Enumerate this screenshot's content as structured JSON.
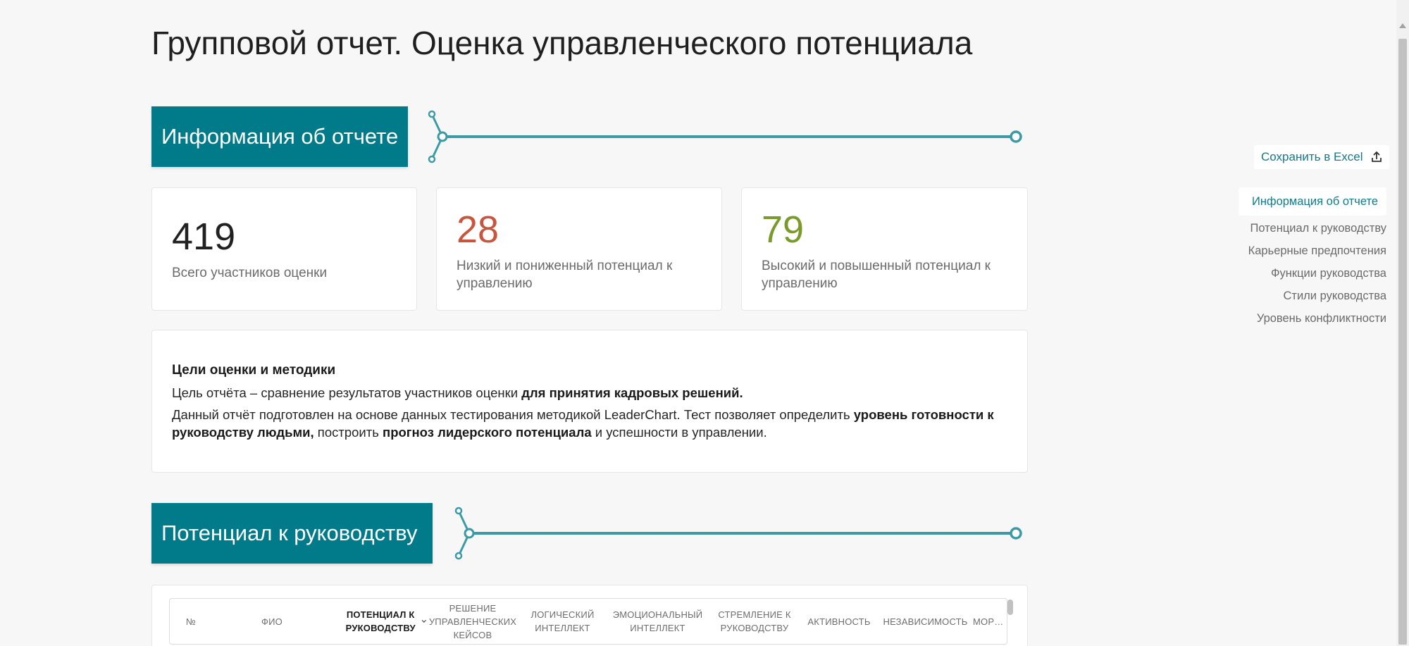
{
  "page": {
    "title": "Групповой отчет. Оценка управленческого потенциала"
  },
  "sections": {
    "info": {
      "title": "Информация об отчете"
    },
    "potential": {
      "title": "Потенциал к руководству"
    }
  },
  "colors": {
    "accent": "#017a8a",
    "low": "#c8553d",
    "high": "#7a9a2b",
    "line": "#3b9aa6"
  },
  "stats": [
    {
      "value": "419",
      "label": "Всего участников оценки",
      "color": "#1a1a1a"
    },
    {
      "value": "28",
      "label": "Низкий и пониженный потенциал к управлению",
      "color": "#c8553d"
    },
    {
      "value": "79",
      "label": "Высокий и повышенный потенциал к управлению",
      "color": "#7a9a2b"
    }
  ],
  "goals": {
    "title": "Цели оценки и методики",
    "p1_pre": "Цель отчёта – сравнение результатов участников оценки ",
    "p1_bold": "для принятия кадровых решений.",
    "p2_pre": "Данный отчёт подготовлен на основе данных тестирования методикой LeaderChart. Тест позволяет определить ",
    "p2_bold1": "уровень готовности к руководству людьми,",
    "p2_mid": " построить ",
    "p2_bold2": "прогноз лидерского потенциала",
    "p2_post": " и успешности в управлении."
  },
  "table": {
    "columns": [
      "№",
      "ФИО",
      "Потенциал к руководству",
      "Решение управленческих кейсов",
      "Логический интеллект",
      "Эмоциональный интеллект",
      "Стремление к руководству",
      "Активность",
      "Независимость",
      "Мор… гиб…"
    ],
    "sorted_column": "Потенциал к руководству"
  },
  "sidebar": {
    "export_label": "Сохранить в Excel",
    "export_icon": "upload-icon",
    "items": [
      {
        "label": "Информация об отчете",
        "active": true
      },
      {
        "label": "Потенциал к руководству"
      },
      {
        "label": "Карьерные предпочтения"
      },
      {
        "label": "Функции руководства"
      },
      {
        "label": "Стили руководства"
      },
      {
        "label": "Уровень конфликтности"
      }
    ]
  }
}
